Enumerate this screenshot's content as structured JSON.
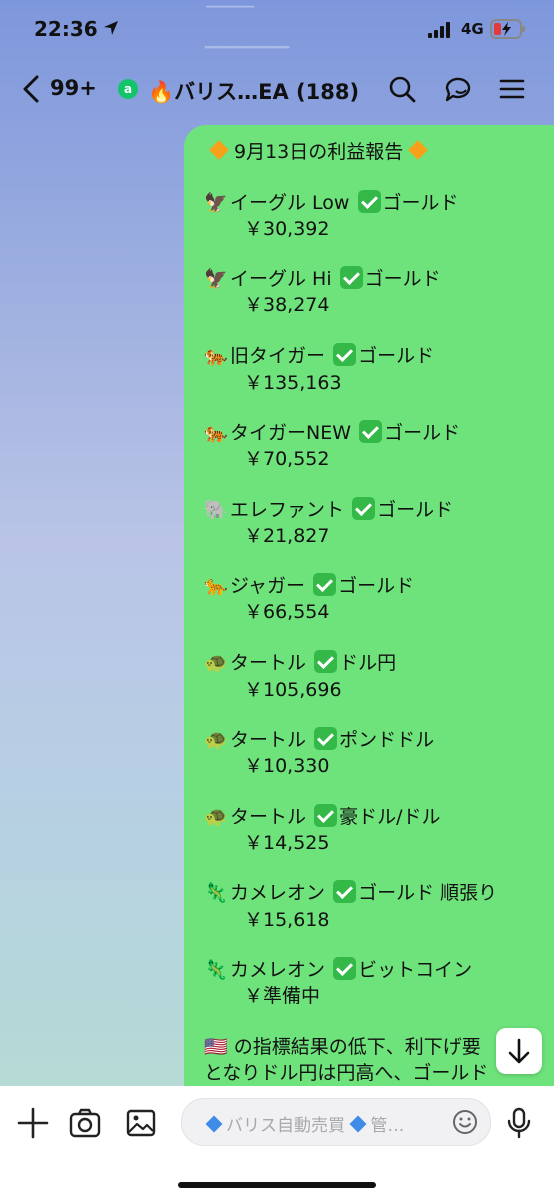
{
  "status": {
    "time": "22:36",
    "network": "4G"
  },
  "nav": {
    "back_count": "99+",
    "title": "🔥バリス…EA (188)",
    "official_badge": "a"
  },
  "messages": [
    {
      "emoji": "🔶",
      "text": "9月13日の利益報告",
      "emoji_after": "🔶"
    },
    {
      "emoji": "🦅",
      "name": "イーグル Low",
      "pair": "ゴールド",
      "amount": "￥30,392"
    },
    {
      "emoji": "🦅",
      "name": "イーグル Hi",
      "pair": "ゴールド",
      "amount": "￥38,274"
    },
    {
      "emoji": "🐅",
      "name": "旧タイガー",
      "pair": "ゴールド",
      "amount": "￥135,163"
    },
    {
      "emoji": "🐅",
      "name": "タイガーNEW",
      "pair": "ゴールド",
      "amount": "￥70,552"
    },
    {
      "emoji": "🐘",
      "name": "エレファント",
      "pair": "ゴールド",
      "amount": "￥21,827"
    },
    {
      "emoji": "🐆",
      "name": "ジャガー",
      "pair": "ゴールド",
      "amount": "￥66,554"
    },
    {
      "emoji": "🐢",
      "name": "タートル",
      "pair": "ドル円",
      "amount": "￥105,696"
    },
    {
      "emoji": "🐢",
      "name": "タートル",
      "pair": "ポンドドル",
      "amount": "￥10,330"
    },
    {
      "emoji": "🐢",
      "name": "タートル",
      "pair": "豪ドル/ドル",
      "amount": "￥14,525"
    },
    {
      "emoji": "🦎",
      "name": "カメレオン",
      "pair": "ゴールド 順張り",
      "amount": "￥15,618"
    },
    {
      "emoji": "🦎",
      "name": "カメレオン",
      "pair": "ビットコイン",
      "amount": "￥準備中"
    }
  ],
  "footer_text": {
    "line1": "🇺🇸 の指標結果の低下、利下げ要",
    "line2": "となりドル円は円高へ、ゴールド"
  },
  "input": {
    "placeholder": "バリス自動売買",
    "placeholder_suffix": "管…"
  },
  "colors": {
    "bubble": "#6ee27b",
    "check": "#34b948",
    "accent": "#12c46a"
  }
}
